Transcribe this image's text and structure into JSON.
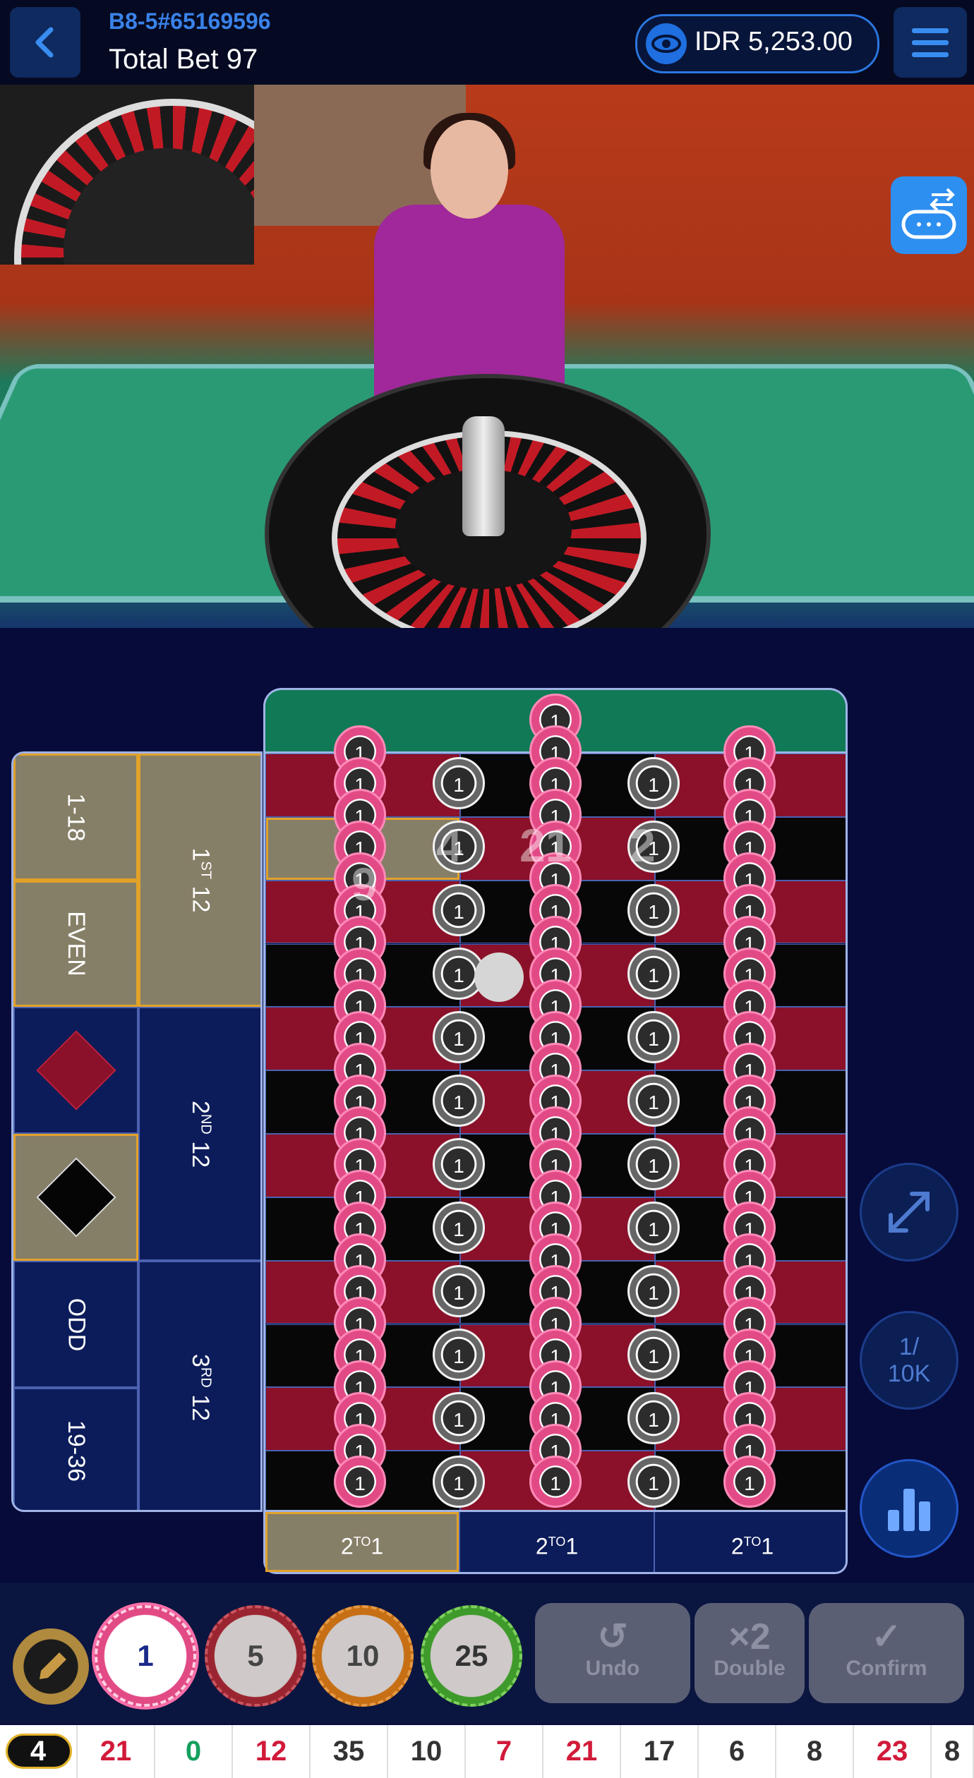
{
  "header": {
    "round_id": "B8-5#65169596",
    "total_bet": "Total Bet 97",
    "balance": "IDR 5,253.00"
  },
  "icons": {
    "back": "chevron-left-icon",
    "balance": "eye-icon",
    "menu": "hamburger-menu-icon",
    "swap": "switch-view-icon",
    "fullscreen": "expand-icon",
    "stats": "bar-chart-icon",
    "edit": "pencil-icon"
  },
  "colors": {
    "red": "#8a1129",
    "black": "#070707",
    "green": "#0f7a55",
    "highlight": "#e2a22a",
    "chip_pink": "#e24a86"
  },
  "board": {
    "columns": [
      {
        "label": "2",
        "sup": "TO",
        "suffix": "1",
        "highlighted": true
      },
      {
        "label": "2",
        "sup": "TO",
        "suffix": "1",
        "highlighted": false
      },
      {
        "label": "2",
        "sup": "TO",
        "suffix": "1",
        "highlighted": false
      }
    ],
    "dozens": [
      {
        "label": "1",
        "sup": "ST",
        "suffix": " 12"
      },
      {
        "label": "2",
        "sup": "ND",
        "suffix": " 12"
      },
      {
        "label": "3",
        "sup": "RD",
        "suffix": " 12"
      }
    ],
    "outside": {
      "low": "1-18",
      "even": "EVEN",
      "odd": "ODD",
      "high": "19-36"
    },
    "chip_value": "1",
    "ghost_numbers": [
      "9",
      "4",
      "21",
      "2"
    ]
  },
  "side_buttons": {
    "limit": "1/\n10K"
  },
  "chips": [
    "1",
    "5",
    "10",
    "25"
  ],
  "actions": {
    "undo": "Undo",
    "double": "Double",
    "double_icon": "×2",
    "confirm": "Confirm"
  },
  "history": [
    {
      "n": "4",
      "c": "black",
      "latest": true
    },
    {
      "n": "21",
      "c": "red"
    },
    {
      "n": "0",
      "c": "green"
    },
    {
      "n": "12",
      "c": "red"
    },
    {
      "n": "35",
      "c": "black"
    },
    {
      "n": "10",
      "c": "black"
    },
    {
      "n": "7",
      "c": "red"
    },
    {
      "n": "21",
      "c": "red"
    },
    {
      "n": "17",
      "c": "black"
    },
    {
      "n": "6",
      "c": "black"
    },
    {
      "n": "8",
      "c": "black"
    },
    {
      "n": "23",
      "c": "red"
    },
    {
      "n": "8",
      "c": "black"
    }
  ]
}
